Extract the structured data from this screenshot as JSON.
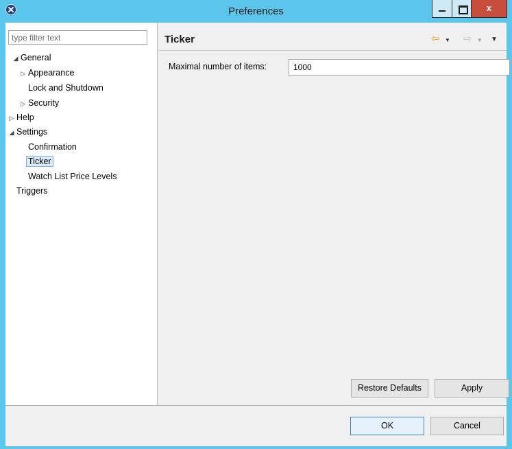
{
  "window": {
    "title": "Preferences"
  },
  "filter": {
    "placeholder": "type filter text"
  },
  "tree": {
    "general": "General",
    "appearance": "Appearance",
    "lock_shutdown": "Lock and Shutdown",
    "security": "Security",
    "help": "Help",
    "settings": "Settings",
    "confirmation": "Confirmation",
    "ticker": "Ticker",
    "watch_list": "Watch List Price Levels",
    "triggers": "Triggers",
    "selected": "Ticker"
  },
  "page": {
    "title": "Ticker",
    "max_items_label": "Maximal number of items:",
    "max_items_value": "1000"
  },
  "buttons": {
    "restore_defaults": "Restore Defaults",
    "apply": "Apply",
    "ok": "OK",
    "cancel": "Cancel"
  },
  "icons": {
    "app": "app-icon",
    "back": "back-arrow-icon",
    "forward": "forward-arrow-icon"
  },
  "colors": {
    "titlebar": "#5bc5eb",
    "close_button": "#c74d3c",
    "selection": "#dcebfc"
  }
}
